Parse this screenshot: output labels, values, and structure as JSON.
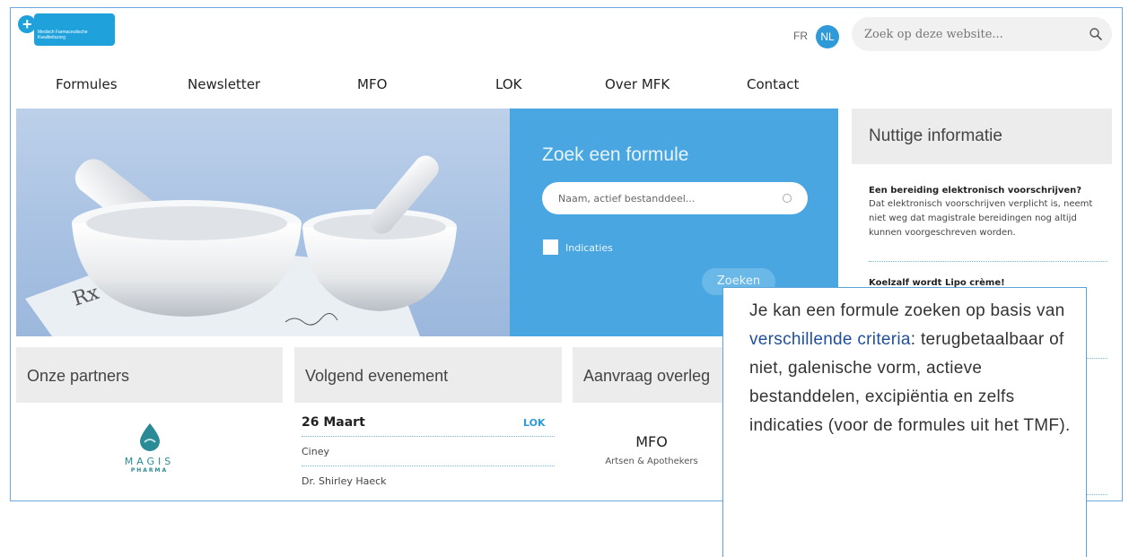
{
  "header": {
    "logo": {
      "mark": "mfk",
      "tagline": "Medisch Farmaceutische Kwaliteitszorg"
    },
    "languages": [
      {
        "label": "FR",
        "active": false
      },
      {
        "label": "NL",
        "active": true
      }
    ],
    "search": {
      "placeholder": "Zoek op deze website...",
      "icon": "search-icon"
    }
  },
  "nav": [
    "Formules",
    "Newsletter",
    "MFO",
    "LOK",
    "Over MFK",
    "Contact"
  ],
  "hero": {
    "image_alt": "mortar-and-pestle",
    "rx_text": "Rx",
    "search_title": "Zoek een formule",
    "input_placeholder": "Naam, actief bestanddeel...",
    "checkbox_label": "Indicaties",
    "button_label": "Zoeken"
  },
  "info": {
    "title": "Nuttige informatie",
    "items": [
      {
        "title": "Een bereiding elektronisch voorschrijven?",
        "body": "Dat elektronisch voorschrijven verplicht is, neemt niet weg dat magistrale bereidingen nog altijd kunnen voorgeschreven worden."
      },
      {
        "title": "Koelzalf wordt Lipo crème!"
      }
    ]
  },
  "partners": {
    "title": "Onze partners",
    "logo_text": "MAGIS",
    "logo_sub": "PHARMA"
  },
  "event": {
    "title": "Volgend evenement",
    "date": "26 Maart",
    "tag": "LOK",
    "place": "Ciney",
    "speaker": "Dr. Shirley Haeck"
  },
  "overleg": {
    "title": "Aanvraag overleg",
    "label": "MFO",
    "sub": "Artsen & Apothekers"
  },
  "callout": {
    "text_1": "Je kan een formule zoeken op basis van ",
    "highlight": "verschillende criteria",
    "text_2": ": terugbetaalbaar of niet, galenische vorm, actieve bestanddelen, excipiëntia en zelfs indicaties (voor de formules uit het TMF)."
  },
  "colors": {
    "accent": "#2e9ad8",
    "panel": "#4aa6e0",
    "header_grey": "#ececec",
    "highlight": "#1f4f9a"
  }
}
